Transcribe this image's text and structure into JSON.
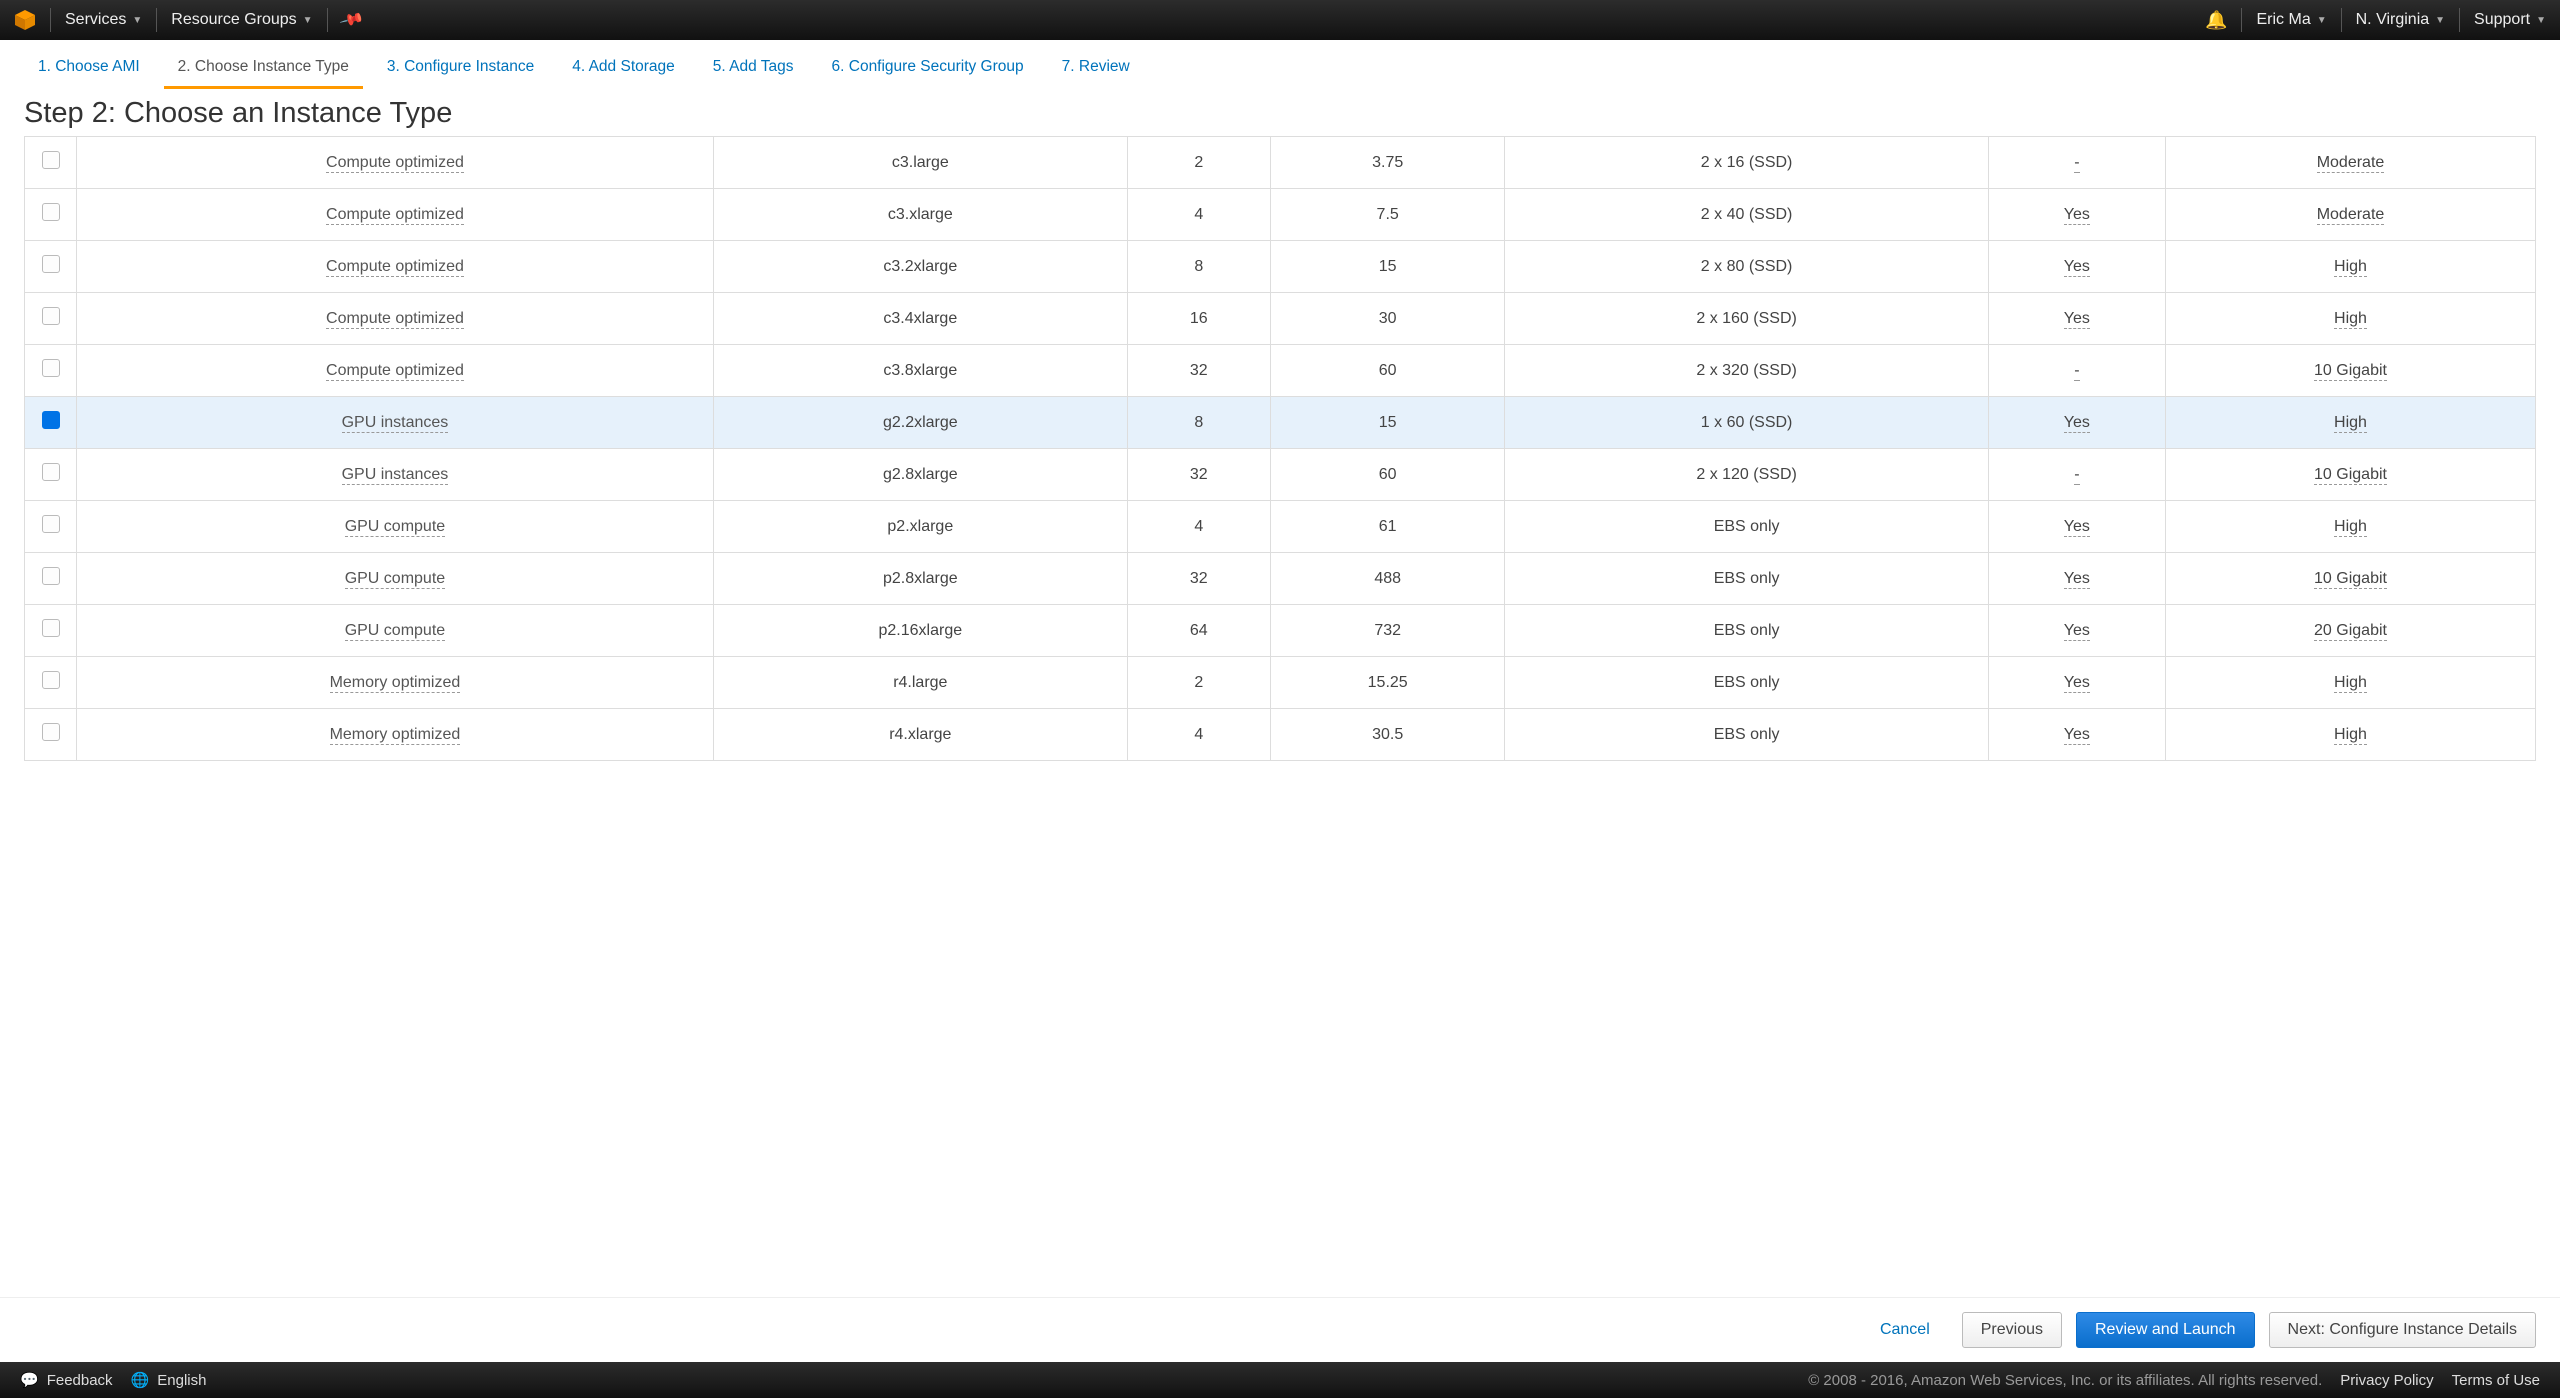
{
  "topbar": {
    "services": "Services",
    "resource_groups": "Resource Groups",
    "user": "Eric Ma",
    "region": "N. Virginia",
    "support": "Support"
  },
  "wizard": {
    "tabs": [
      "1. Choose AMI",
      "2. Choose Instance Type",
      "3. Configure Instance",
      "4. Add Storage",
      "5. Add Tags",
      "6. Configure Security Group",
      "7. Review"
    ],
    "active_index": 1
  },
  "heading": "Step 2: Choose an Instance Type",
  "rows": [
    {
      "sel": false,
      "family": "Compute optimized",
      "type": "c3.large",
      "vcpu": "2",
      "mem": "3.75",
      "storage": "2 x 16 (SSD)",
      "ebs": "-",
      "net": "Moderate"
    },
    {
      "sel": false,
      "family": "Compute optimized",
      "type": "c3.xlarge",
      "vcpu": "4",
      "mem": "7.5",
      "storage": "2 x 40 (SSD)",
      "ebs": "Yes",
      "net": "Moderate"
    },
    {
      "sel": false,
      "family": "Compute optimized",
      "type": "c3.2xlarge",
      "vcpu": "8",
      "mem": "15",
      "storage": "2 x 80 (SSD)",
      "ebs": "Yes",
      "net": "High"
    },
    {
      "sel": false,
      "family": "Compute optimized",
      "type": "c3.4xlarge",
      "vcpu": "16",
      "mem": "30",
      "storage": "2 x 160 (SSD)",
      "ebs": "Yes",
      "net": "High"
    },
    {
      "sel": false,
      "family": "Compute optimized",
      "type": "c3.8xlarge",
      "vcpu": "32",
      "mem": "60",
      "storage": "2 x 320 (SSD)",
      "ebs": "-",
      "net": "10 Gigabit"
    },
    {
      "sel": true,
      "family": "GPU instances",
      "type": "g2.2xlarge",
      "vcpu": "8",
      "mem": "15",
      "storage": "1 x 60 (SSD)",
      "ebs": "Yes",
      "net": "High"
    },
    {
      "sel": false,
      "family": "GPU instances",
      "type": "g2.8xlarge",
      "vcpu": "32",
      "mem": "60",
      "storage": "2 x 120 (SSD)",
      "ebs": "-",
      "net": "10 Gigabit"
    },
    {
      "sel": false,
      "family": "GPU compute",
      "type": "p2.xlarge",
      "vcpu": "4",
      "mem": "61",
      "storage": "EBS only",
      "ebs": "Yes",
      "net": "High"
    },
    {
      "sel": false,
      "family": "GPU compute",
      "type": "p2.8xlarge",
      "vcpu": "32",
      "mem": "488",
      "storage": "EBS only",
      "ebs": "Yes",
      "net": "10 Gigabit"
    },
    {
      "sel": false,
      "family": "GPU compute",
      "type": "p2.16xlarge",
      "vcpu": "64",
      "mem": "732",
      "storage": "EBS only",
      "ebs": "Yes",
      "net": "20 Gigabit"
    },
    {
      "sel": false,
      "family": "Memory optimized",
      "type": "r4.large",
      "vcpu": "2",
      "mem": "15.25",
      "storage": "EBS only",
      "ebs": "Yes",
      "net": "High"
    },
    {
      "sel": false,
      "family": "Memory optimized",
      "type": "r4.xlarge",
      "vcpu": "4",
      "mem": "30.5",
      "storage": "EBS only",
      "ebs": "Yes",
      "net": "High"
    }
  ],
  "actions": {
    "cancel": "Cancel",
    "previous": "Previous",
    "review": "Review and Launch",
    "next": "Next: Configure Instance Details"
  },
  "footer": {
    "feedback": "Feedback",
    "language": "English",
    "copyright": "© 2008 - 2016, Amazon Web Services, Inc. or its affiliates. All rights reserved.",
    "privacy": "Privacy Policy",
    "terms": "Terms of Use"
  }
}
